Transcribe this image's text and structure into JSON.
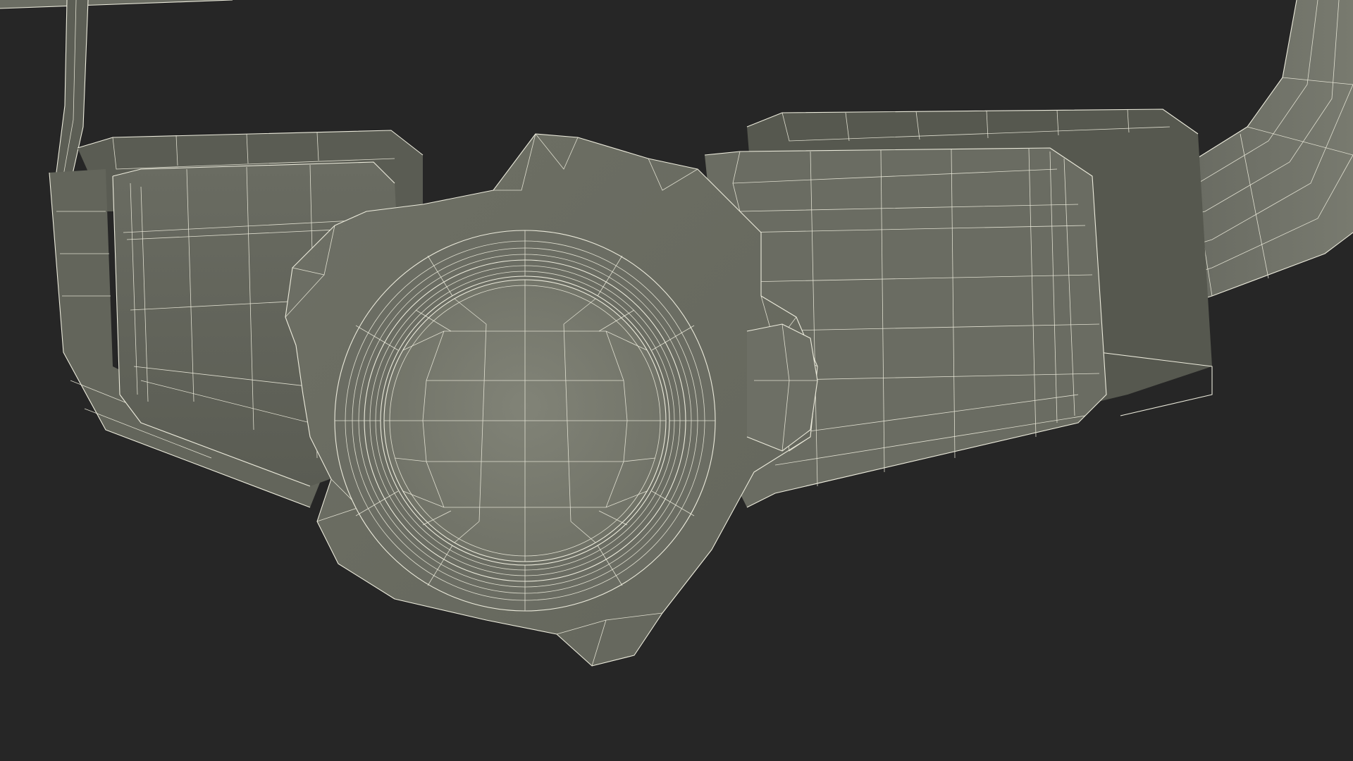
{
  "scene": {
    "subject": "wireframe-3d-model",
    "background_color": "#262626",
    "surface_color": "#74766b",
    "surface_shadow_color": "#5a5c52",
    "wire_color": "#ecebdc"
  }
}
